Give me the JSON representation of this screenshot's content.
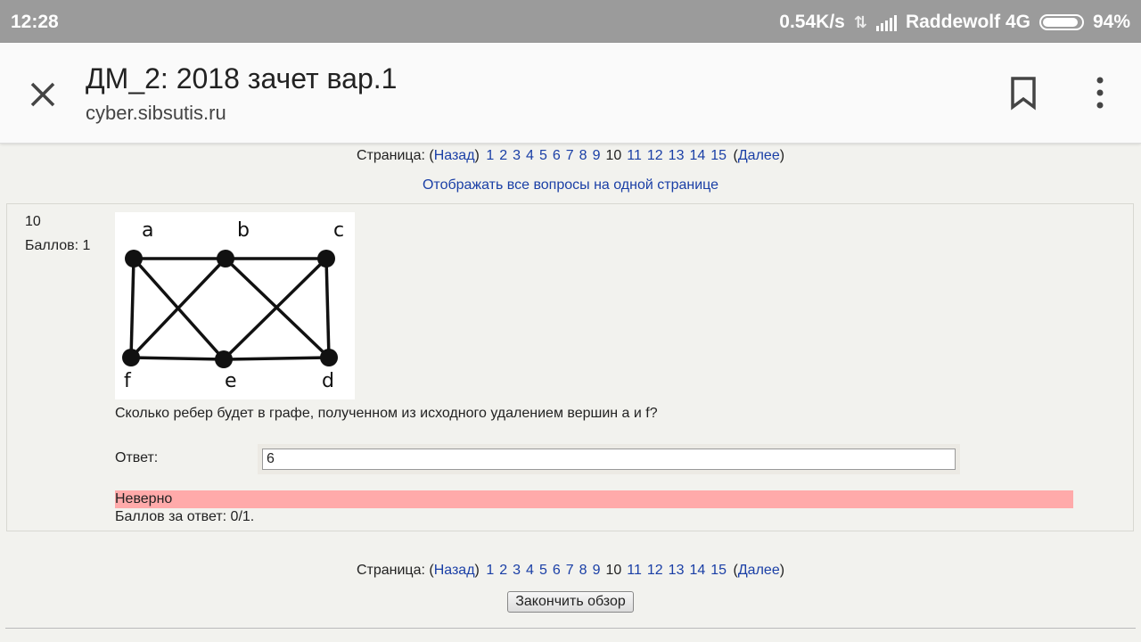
{
  "status_bar": {
    "time": "12:28",
    "speed": "0.54K/s",
    "carrier": "Raddewolf 4G",
    "battery": "94%",
    "battery_level": 0.94
  },
  "browser": {
    "title": "ДМ_2: 2018 зачет вар.1",
    "url": "cyber.sibsutis.ru"
  },
  "pagination": {
    "label": "Страница: (",
    "prev": "Назад",
    "pages": [
      "1",
      "2",
      "3",
      "4",
      "5",
      "6",
      "7",
      "8",
      "9",
      "10",
      "11",
      "12",
      "13",
      "14",
      "15"
    ],
    "current": "10",
    "next": "Далее",
    "close_paren": ")"
  },
  "show_all_link": "Отображать все вопросы на одной странице",
  "question": {
    "number": "10",
    "grade": "Баллов: 1",
    "text": "Сколько ребер будет в графе, полученном из исходного удалением вершин a и f?",
    "answer_label": "Ответ:",
    "answer_value": "6",
    "feedback": "Неверно",
    "score": "Баллов за ответ: 0/1.",
    "graph": {
      "vertices": [
        "a",
        "b",
        "c",
        "d",
        "e",
        "f"
      ],
      "edges": [
        [
          "a",
          "b"
        ],
        [
          "b",
          "c"
        ],
        [
          "a",
          "f"
        ],
        [
          "c",
          "d"
        ],
        [
          "f",
          "e"
        ],
        [
          "e",
          "d"
        ],
        [
          "a",
          "e"
        ],
        [
          "b",
          "f"
        ],
        [
          "b",
          "d"
        ],
        [
          "c",
          "e"
        ]
      ]
    }
  },
  "finish_button": "Закончить обзор",
  "colors": {
    "status_bar": "#9b9b9b",
    "link": "#1a3fa6",
    "feedback_bg": "#ffaaaa",
    "page_bg": "#f2f2ee"
  },
  "icons": {
    "close": "close-icon",
    "bookmark": "bookmark-icon",
    "menu": "more-vert-icon",
    "signal": "signal-icon",
    "battery": "battery-icon"
  }
}
